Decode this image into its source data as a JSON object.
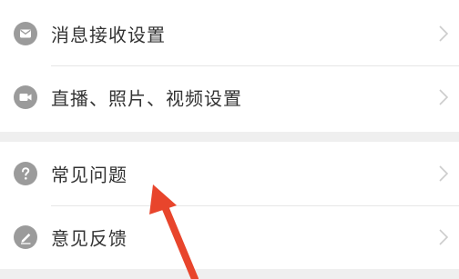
{
  "settings": {
    "items": [
      {
        "label": "消息接收设置",
        "icon": "message-icon"
      },
      {
        "label": "直播、照片、视频设置",
        "icon": "video-camera-icon"
      }
    ]
  },
  "help": {
    "items": [
      {
        "label": "常见问题",
        "icon": "question-icon"
      },
      {
        "label": "意见反馈",
        "icon": "edit-icon"
      }
    ]
  },
  "colors": {
    "icon_gray": "#9b9b9b",
    "text": "#333333",
    "chevron": "#cccccc",
    "background": "#efefef",
    "annotation_arrow": "#e8452c"
  },
  "annotation": {
    "icon": "red-arrow-icon"
  }
}
